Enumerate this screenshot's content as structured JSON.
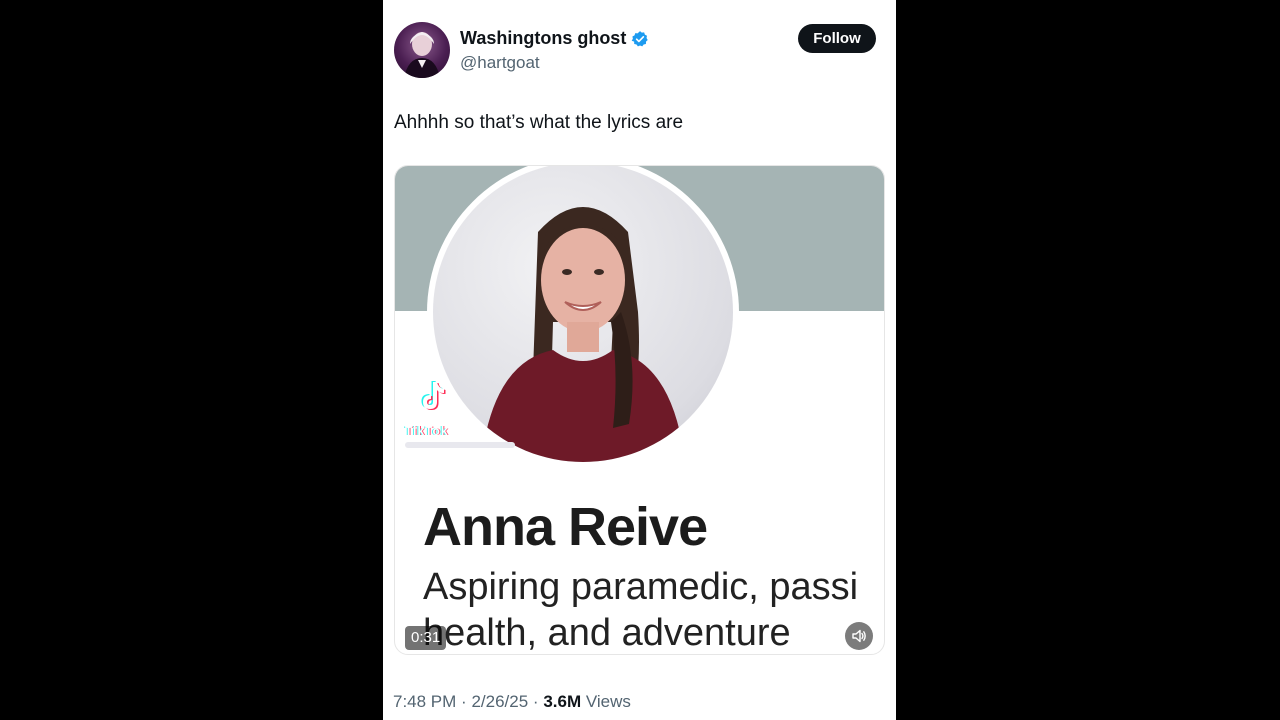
{
  "author": {
    "display_name": "Washingtons ghost",
    "handle": "@hartgoat",
    "verified": true
  },
  "follow_label": "Follow",
  "tweet_text": "Ahhhh so that’s what the lyrics are",
  "media": {
    "profile_name": "Anna Reive",
    "bio_line1": "Aspiring paramedic, passi",
    "bio_line2": "health, and adventure",
    "duration": "0:31",
    "watermark": "TikTok"
  },
  "meta": {
    "time": "7:48 PM",
    "date": "2/26/25",
    "separator": "·",
    "views_count": "3.6M",
    "views_label": "Views"
  },
  "colors": {
    "text_primary": "#0f1419",
    "text_secondary": "#536471",
    "verified_blue": "#1d9bf0",
    "banner": "#a5b4b4"
  },
  "icons": [
    "verified-badge-icon",
    "tiktok-logo-icon",
    "volume-icon"
  ]
}
